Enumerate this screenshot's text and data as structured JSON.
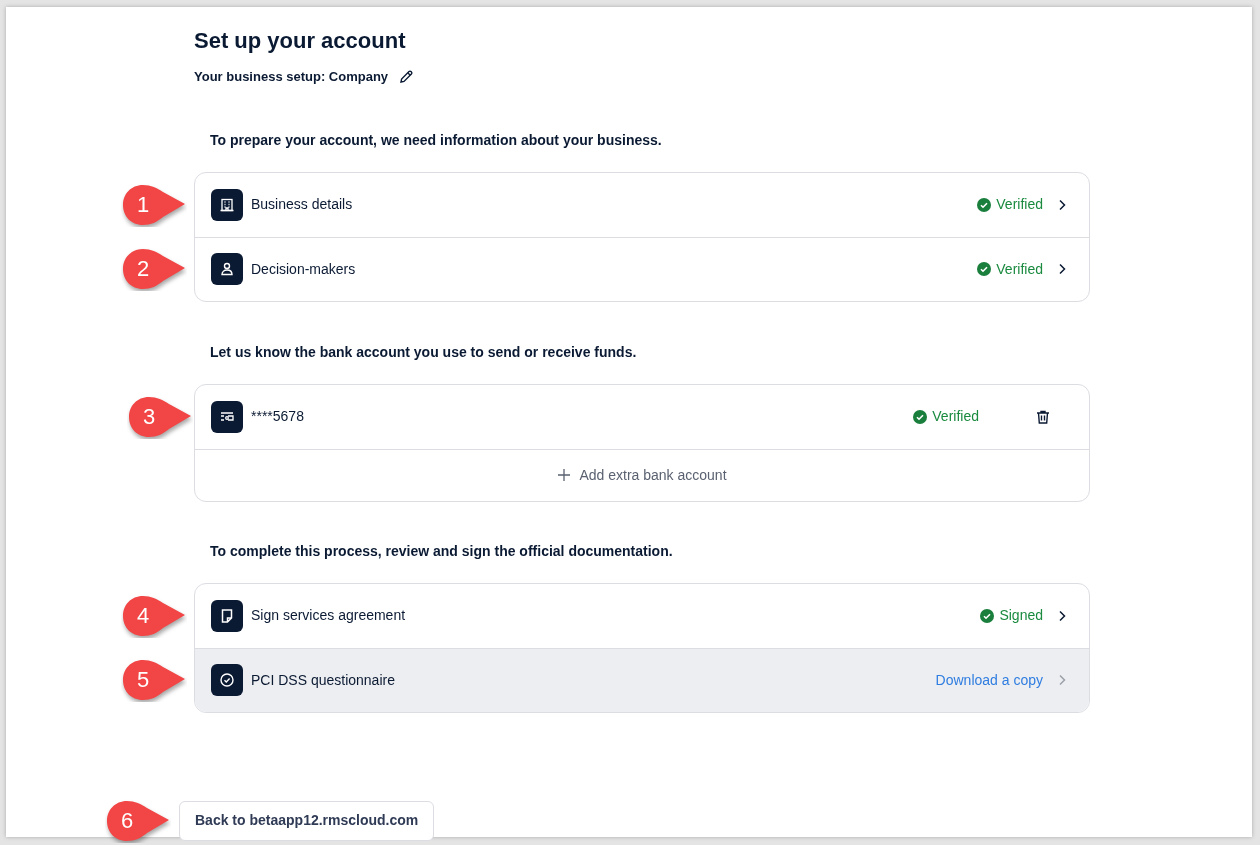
{
  "title": "Set up your account",
  "setup": {
    "label": "Your business setup: Company"
  },
  "sections": [
    {
      "heading": "To prepare your account, we need information about your business.",
      "rows": [
        {
          "callout": "1",
          "label": "Business details",
          "kind": "status",
          "status": "Verified",
          "highlighted": false
        },
        {
          "callout": "2",
          "label": "Decision-makers",
          "kind": "status",
          "status": "Verified",
          "highlighted": false
        }
      ]
    },
    {
      "heading": "Let us know the bank account you use to send or receive funds.",
      "rows": [
        {
          "callout": "3",
          "label": "****5678",
          "kind": "account",
          "status": "Verified",
          "highlighted": false
        }
      ],
      "footer": {
        "label": "Add extra bank account"
      }
    },
    {
      "heading": "To complete this process, review and sign the official documentation.",
      "rows": [
        {
          "callout": "4",
          "label": "Sign services agreement",
          "kind": "status",
          "status": "Signed",
          "highlighted": false
        },
        {
          "callout": "5",
          "label": "PCI DSS questionnaire",
          "kind": "link",
          "link": "Download a copy",
          "highlighted": true
        }
      ]
    }
  ],
  "back_button": {
    "callout": "6",
    "label": "Back to betaapp12.rmscloud.com"
  }
}
